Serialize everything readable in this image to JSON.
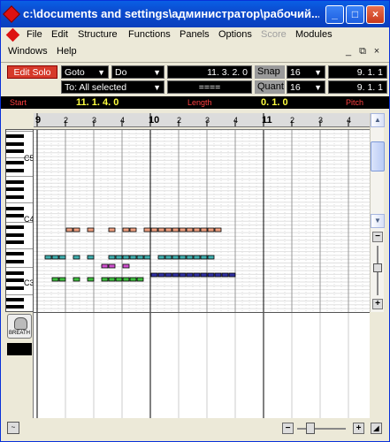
{
  "window": {
    "title": "c:\\documents and settings\\администратор\\рабочий..."
  },
  "menu1": [
    "File",
    "Edit",
    "Structure",
    "Functions",
    "Panels",
    "Options",
    "Score",
    "Modules"
  ],
  "menu1_disabled": [
    "Score"
  ],
  "menu2": [
    "Windows",
    "Help"
  ],
  "mdi": {
    "minimize": "_",
    "restore": "⧉",
    "close": "×"
  },
  "toolbar": {
    "edit_solo": "Edit Solo",
    "goto": "Goto",
    "do": "Do",
    "to": "To: All selected",
    "position": "11. 3. 2.   0",
    "bars": "====",
    "snap_label": "Snap",
    "snap_value": "16",
    "quant_label": "Quant",
    "quant_value": "16",
    "right_pos1": "9. 1. 1",
    "right_pos2": "9. 1. 1"
  },
  "infoline": {
    "start_label": "Start",
    "start_value": "11. 1. 4.     0",
    "length_label": "Length",
    "length_value": "0. 1.     0",
    "pitch_label": "Pitch"
  },
  "ruler": {
    "ticks": [
      "9",
      "2",
      "3",
      "4",
      "10",
      "2",
      "3",
      "4",
      "11",
      "2",
      "3",
      "4"
    ]
  },
  "keyboard": {
    "octaves": [
      "C5",
      "C4",
      "C3"
    ]
  },
  "controller": {
    "label": "BREATH"
  },
  "colors": {
    "note_salmon": "#f0a080",
    "note_teal": "#40b0b0",
    "note_magenta": "#d050d0",
    "note_green": "#40c040",
    "note_navy": "#3030a0"
  },
  "notes": [
    {
      "row": 0,
      "steps": [
        4,
        5,
        7,
        10,
        12,
        13,
        15,
        16,
        17,
        18,
        19,
        20,
        21,
        22,
        23,
        24,
        25
      ]
    },
    {
      "row": 1,
      "steps": [
        1,
        2,
        3,
        5,
        7,
        10,
        11,
        12,
        13,
        14,
        15,
        17,
        18,
        19,
        20,
        21,
        22,
        23,
        24
      ]
    },
    {
      "row": 2,
      "steps": [
        9,
        10,
        12
      ]
    },
    {
      "row": 3,
      "steps": [
        16,
        17,
        18,
        19,
        20,
        21,
        22,
        23,
        24,
        25,
        26,
        27
      ]
    },
    {
      "row": 4,
      "steps": [
        2,
        3,
        5,
        7,
        9,
        10,
        11,
        12,
        13,
        14
      ]
    }
  ]
}
